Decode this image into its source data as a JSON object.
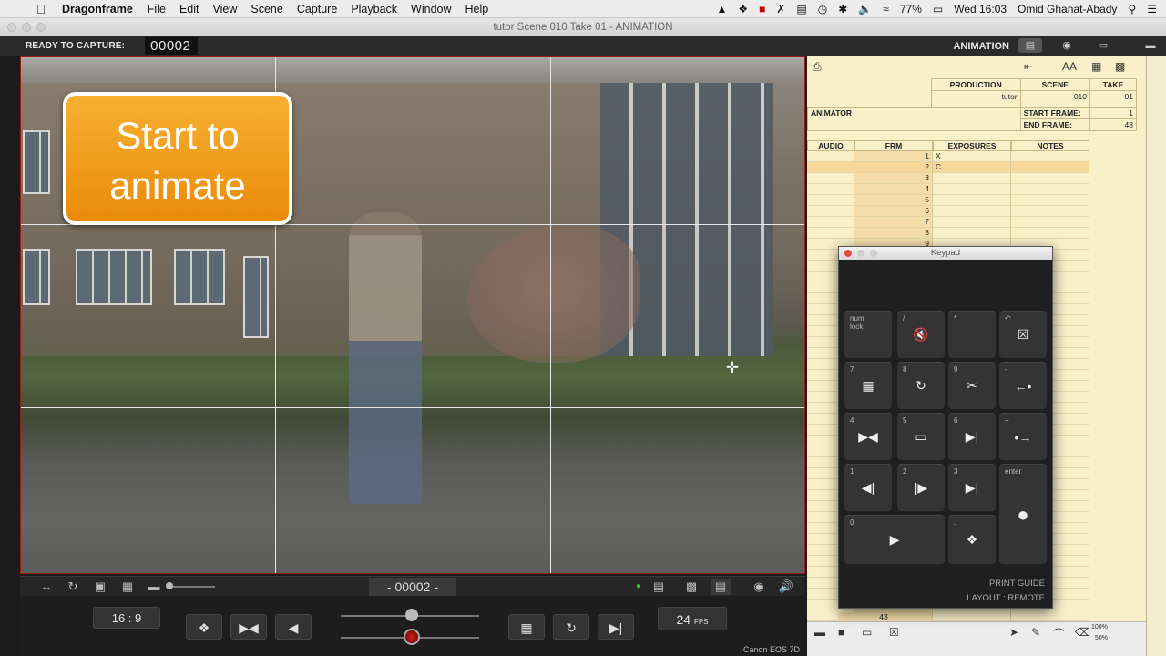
{
  "menubar": {
    "app_name": "Dragonframe",
    "items": [
      "File",
      "Edit",
      "View",
      "Scene",
      "Capture",
      "Playback",
      "Window",
      "Help"
    ],
    "battery": "77%",
    "clock": "Wed 16:03",
    "user": "Omid Ghanat-Abady"
  },
  "window": {
    "title": "tutor  Scene 010  Take 01 - ANIMATION"
  },
  "status": {
    "ready_label": "READY TO CAPTURE:",
    "frame_number": "00002",
    "mode_label": "ANIMATION"
  },
  "overlay": {
    "line1": "Start to",
    "line2": "animate"
  },
  "controls": {
    "frame_readout": "- 00002 -",
    "aspect": "16 : 9",
    "fps_value": "24",
    "fps_unit": "FPS",
    "camera": "Canon EOS 7D"
  },
  "xsheet": {
    "production_label": "PRODUCTION",
    "scene_label": "SCENE",
    "take_label": "TAKE",
    "production": "tutor",
    "scene": "010",
    "take": "01",
    "animator_label": "ANIMATOR",
    "start_frame_label": "START FRAME:",
    "start_frame": "1",
    "end_frame_label": "END FRAME:",
    "end_frame": "48",
    "col_audio": "AUDIO",
    "col_frm": "FRM",
    "col_exposures": "EXPOSURES",
    "col_notes": "NOTES",
    "rows": [
      {
        "frm": "1",
        "exp": "X"
      },
      {
        "frm": "2",
        "exp": "C"
      },
      {
        "frm": "3",
        "exp": ""
      },
      {
        "frm": "4",
        "exp": ""
      },
      {
        "frm": "5",
        "exp": ""
      },
      {
        "frm": "6",
        "exp": ""
      },
      {
        "frm": "7",
        "exp": ""
      },
      {
        "frm": "8",
        "exp": ""
      },
      {
        "frm": "9",
        "exp": ""
      }
    ],
    "bottom_frame": "43",
    "zoom_top": "100%",
    "zoom_bottom": "50%"
  },
  "keypad": {
    "title": "Keypad",
    "num_lock": "num lock",
    "print_guide": "PRINT GUIDE",
    "layout": "LAYOUT : REMOTE",
    "enter": "enter"
  }
}
